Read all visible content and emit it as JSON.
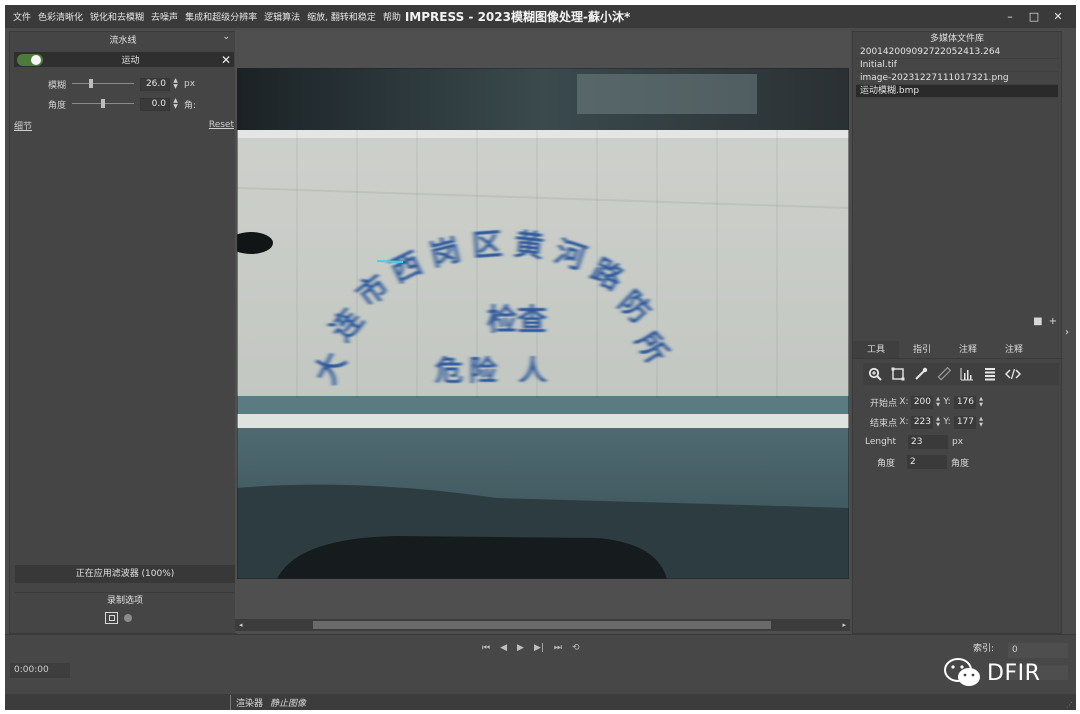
{
  "menu": [
    "文件",
    "色彩清晰化",
    "锐化和去模糊",
    "去噪声",
    "集成和超级分辨率",
    "逻辑算法",
    "缩放, 翻转和稳定",
    "帮助"
  ],
  "app_title": "IMPRESS - 2023模糊图像处理-蘇小沐*",
  "window_controls": {
    "minimize": "–",
    "maximize": "□",
    "close": "✕"
  },
  "left_panel": {
    "header": "流水线",
    "filter": {
      "name": "运动",
      "enabled": true
    },
    "params": [
      {
        "label": "模糊",
        "value": "26.0",
        "unit": "px",
        "level": 0.3
      },
      {
        "label": "角度",
        "value": "0.0",
        "unit": "角度",
        "level": 0.5
      }
    ],
    "details_link": "细节",
    "reset_link": "Reset",
    "applying_status": "正在应用滤波器 (100%)",
    "record_title": "录制选项"
  },
  "right_panel": {
    "library_title": "多媒体文件库",
    "files": [
      {
        "name": "20014200909272205​2413.264",
        "selected": false
      },
      {
        "name": "Initial.tif",
        "selected": false
      },
      {
        "name": "image-20231227111017321.png",
        "selected": false
      },
      {
        "name": "运动模糊.bmp",
        "selected": true
      }
    ],
    "tabs": [
      "工具",
      "指引",
      "注释",
      "注释"
    ],
    "tools": [
      "zoom-icon",
      "crop-icon",
      "eyedropper-icon",
      "ruler-icon",
      "histogram-icon",
      "stack-icon",
      "code-icon"
    ],
    "start": {
      "label": "开始点",
      "x": "200",
      "y": "176"
    },
    "end": {
      "label": "结束点",
      "x": "223",
      "y": "177"
    },
    "length": {
      "label": "Lenght",
      "value": "23",
      "unit": "px"
    },
    "angle": {
      "label": "角度",
      "value": "2",
      "unit": "角度"
    }
  },
  "bottom": {
    "timecode": "0:00:00",
    "index_label": "索引:",
    "index_value": "0",
    "watermark": "DFIR",
    "status_renderer": "渲染器",
    "status_mode": "静止图像"
  },
  "image": {
    "arc_text": "大连市西岗区黄河路防所",
    "center_text": "检查",
    "bottom_text": "危险 人"
  }
}
